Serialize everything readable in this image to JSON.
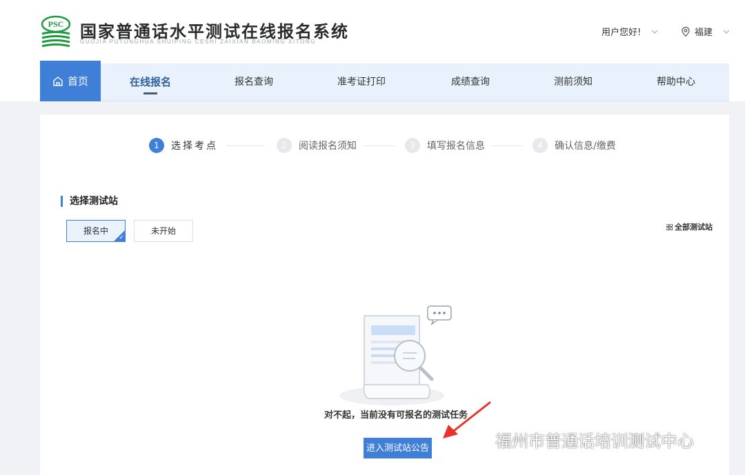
{
  "header": {
    "logo_text": "PSC",
    "site_title": "国家普通话水平测试在线报名系统",
    "site_subtitle": "GUOJIA PUTONGHUA SHUIPING CESHI ZAIXIAN BAOMING XITONG",
    "user_greeting": "用户您好!",
    "region": "福建",
    "icons": [
      "chevron-down-icon",
      "location-pin-icon"
    ]
  },
  "nav": {
    "home": "首页",
    "items": [
      "在线报名",
      "报名查询",
      "准考证打印",
      "成绩查询",
      "测前须知",
      "帮助中心"
    ],
    "active_index": 0
  },
  "steps": [
    {
      "num": "1",
      "label": "选择考点"
    },
    {
      "num": "2",
      "label": "阅读报名须知"
    },
    {
      "num": "3",
      "label": "填写报名信息"
    },
    {
      "num": "4",
      "label": "确认信息/缴费"
    }
  ],
  "section": {
    "title": "选择测试站",
    "tabs": [
      "报名中",
      "未开始"
    ],
    "all_sites": "全部测试站"
  },
  "empty": {
    "message": "对不起，当前没有可报名的测试任务",
    "button": "进入测试站公告"
  },
  "watermark": "福州市普通话培训测试中心",
  "colors": {
    "accent": "#3f7fd8",
    "nav_bg": "#e9f2fc",
    "arrow": "#e8322b"
  }
}
